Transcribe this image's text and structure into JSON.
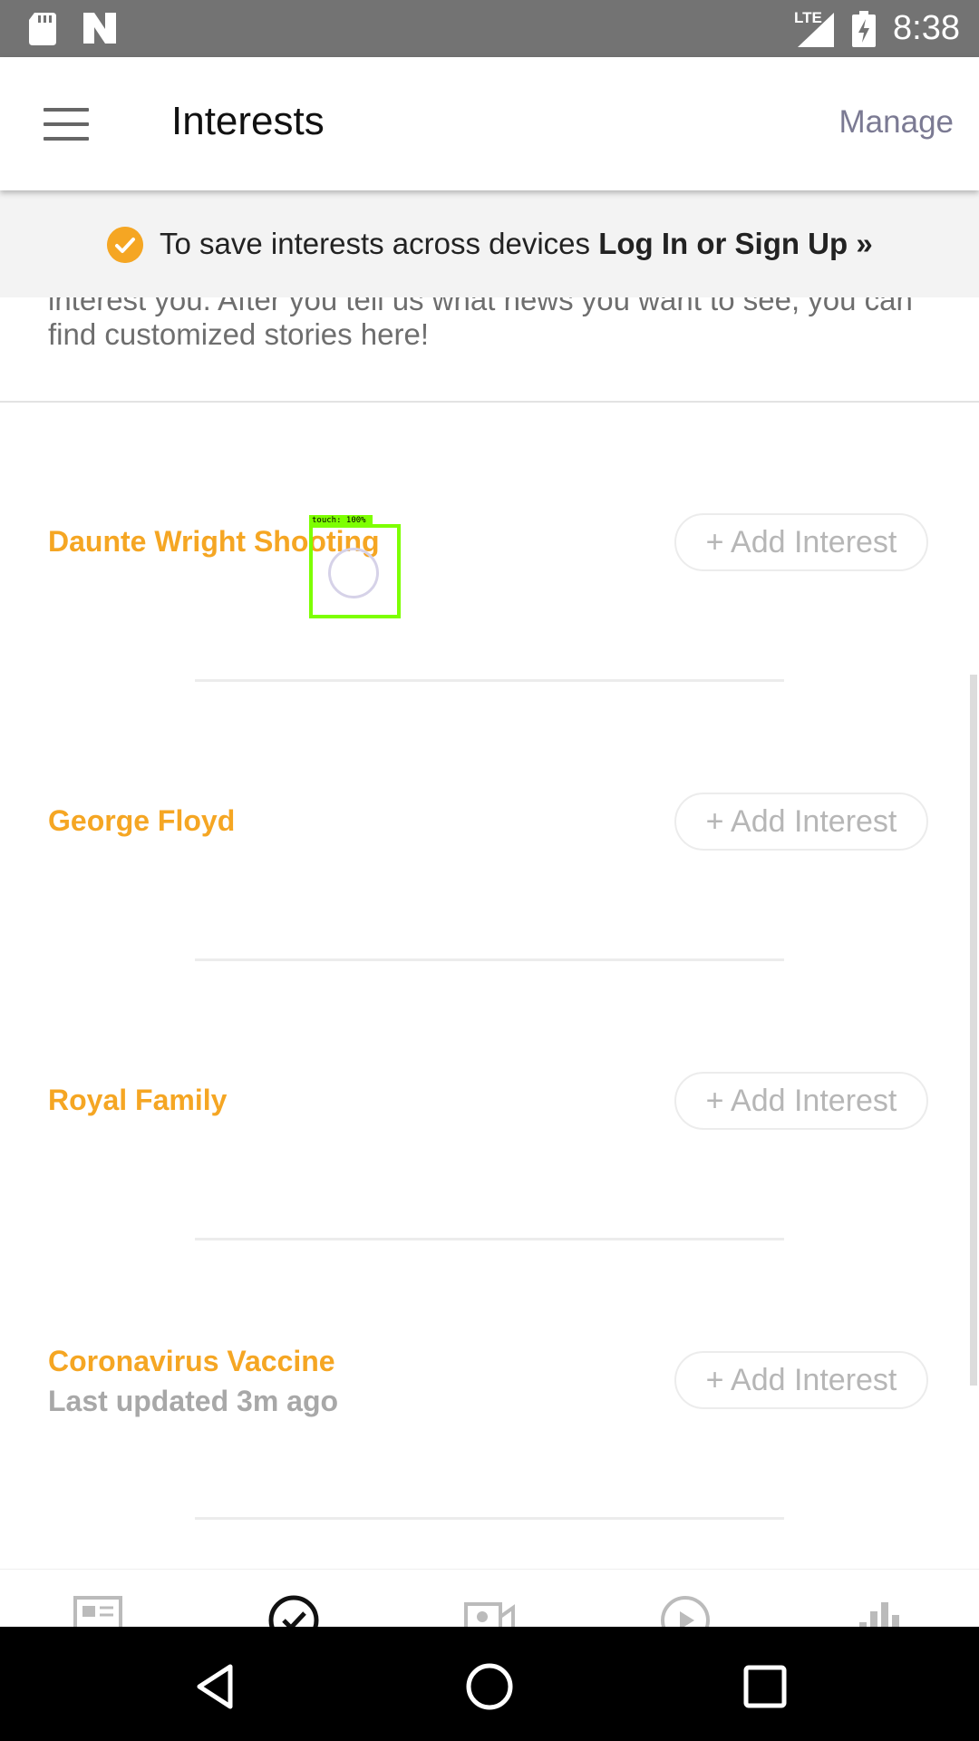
{
  "status_bar": {
    "network": "LTE",
    "time": "8:38"
  },
  "header": {
    "title": "Interests",
    "manage_label": "Manage"
  },
  "banner": {
    "text": "To save interests across devices ",
    "link": "Log In or Sign Up »"
  },
  "intro": {
    "text": "interest you. After you tell us what news you want to see, you can find customized stories here!"
  },
  "topics": [
    {
      "name": "Daunte Wright Shooting",
      "subtitle": "",
      "button": "+ Add Interest"
    },
    {
      "name": "George Floyd",
      "subtitle": "",
      "button": "+ Add Interest"
    },
    {
      "name": "Royal Family",
      "subtitle": "",
      "button": "+ Add Interest"
    },
    {
      "name": "Coronavirus Vaccine",
      "subtitle": "Last updated 3m ago",
      "button": "+ Add Interest"
    }
  ],
  "touch_overlay": {
    "label": "touch: 100%"
  },
  "bottom_tabs": [
    "news-icon",
    "interests-check-icon",
    "video-icon",
    "play-icon",
    "charts-icon"
  ],
  "colors": {
    "accent": "#f5a623",
    "status_bar": "#737373",
    "manage": "#7b7a93"
  }
}
